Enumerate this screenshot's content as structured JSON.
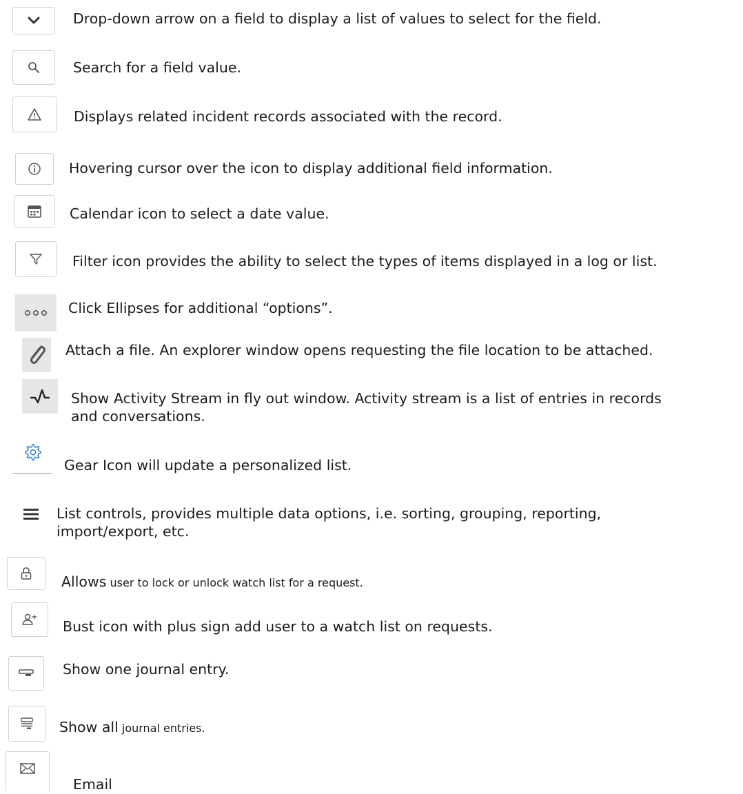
{
  "icon_legend": [
    {
      "icon": "chevron-down-icon",
      "text": "Drop-down arrow on a field to display a list of values to select for the field."
    },
    {
      "icon": "search-icon",
      "text": "Search for a field value."
    },
    {
      "icon": "warning-triangle-icon",
      "text": "Displays related incident records associated with the record."
    },
    {
      "icon": "info-icon",
      "text": "Hovering cursor over the icon to display additional field information."
    },
    {
      "icon": "calendar-icon",
      "text": "Calendar icon to select a date value."
    },
    {
      "icon": "filter-icon",
      "text": "Filter icon provides the ability to select the types of items displayed in a log or list."
    },
    {
      "icon": "ellipsis-icon",
      "text": "Click Ellipses for additional “options”."
    },
    {
      "icon": "paperclip-icon",
      "text": "Attach a file.  An explorer window opens requesting the file location to be attached."
    },
    {
      "icon": "activity-stream-icon",
      "line1": "Show Activity Stream in fly out window.  Activity stream is a list of entries in records",
      "line2": "and conversations."
    },
    {
      "icon": "gear-icon",
      "text": "Gear Icon will update a personalized list."
    },
    {
      "icon": "list-controls-icon",
      "line1": "List controls, provides multiple data options, i.e. sorting, grouping, reporting,",
      "line2": "import/export, etc."
    },
    {
      "icon": "lock-icon",
      "lead": "Allows",
      "rest": " user to lock or unlock watch list for a request."
    },
    {
      "icon": "add-user-icon",
      "text": "Bust icon with plus sign add user to a watch list on requests."
    },
    {
      "icon": "single-journal-entry-icon",
      "text": "Show one journal entry."
    },
    {
      "icon": "all-journal-entries-icon",
      "lead": "Show all",
      "rest": " journal entries."
    },
    {
      "icon": "email-icon",
      "text": "Email"
    }
  ],
  "colors": {
    "text": "#1c1c1c",
    "icon": "#555555",
    "gear": "#3b7fd4",
    "border": "#d2d2d2",
    "shade": "#e6e6e6"
  }
}
